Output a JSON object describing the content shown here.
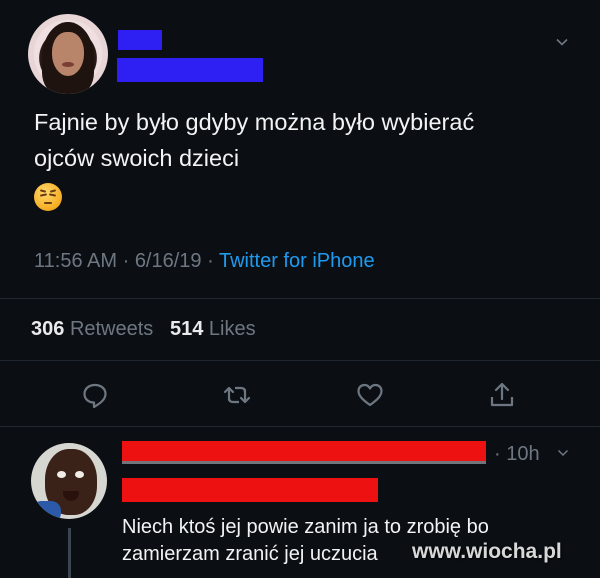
{
  "tweet": {
    "text": "Fajnie by było gdyby można było wybierać\nojców swoich dzieci",
    "emoji": "unamused-face",
    "time": "11:56 AM",
    "date": "6/16/19",
    "separator": " · ",
    "source": "Twitter for iPhone",
    "retweets_count": "306",
    "retweets_label": "Retweets",
    "likes_count": "514",
    "likes_label": "Likes",
    "actions": [
      "reply-icon",
      "retweet-icon",
      "like-icon",
      "share-icon"
    ]
  },
  "reply": {
    "time": "· 10h",
    "text": "Niech ktoś jej powie zanim ja to zrobię bo\nzamierzam zranić jej uczucia"
  },
  "watermark": "www.wiocha.pl",
  "colors": {
    "background": "#0b0f14",
    "link": "#1d9bf0",
    "muted": "#6e7781",
    "redact_blue": "#2e1ff2",
    "redact_red": "#ee1111"
  }
}
